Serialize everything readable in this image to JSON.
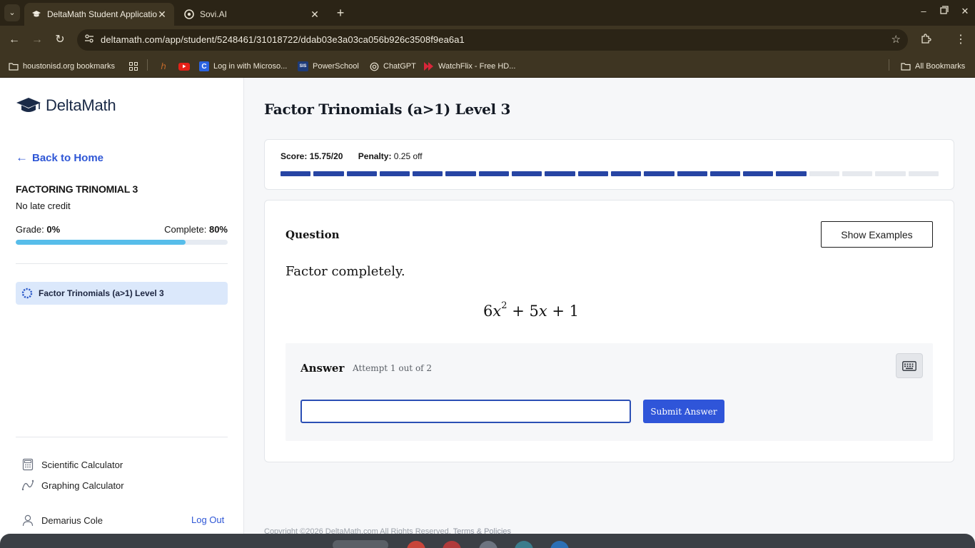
{
  "browser": {
    "tabs": [
      {
        "title": "DeltaMath Student Application",
        "active": true
      },
      {
        "title": "Sovi.AI",
        "active": false
      }
    ],
    "url": "deltamath.com/app/student/5248461/31018722/ddab03e3a03ca056b926c3508f9ea6a1",
    "bookmarks": [
      {
        "label": "houstonisd.org bookmarks",
        "icon": "folder-icon"
      },
      {
        "label": "",
        "icon": "apps-grid-icon"
      },
      {
        "label": "",
        "icon": "llama-icon"
      },
      {
        "label": "",
        "icon": "youtube-icon"
      },
      {
        "label": "Log in with Microso...",
        "icon": "clever-icon"
      },
      {
        "label": "PowerSchool",
        "icon": "powerschool-icon"
      },
      {
        "label": "ChatGPT",
        "icon": "chatgpt-icon"
      },
      {
        "label": "WatchFlix - Free HD...",
        "icon": "watchflix-icon"
      }
    ],
    "all_bookmarks": "All Bookmarks"
  },
  "sidebar": {
    "brand": "DeltaMath",
    "back_link": "Back to Home",
    "assignment_title": "FACTORING TRINOMIAL 3",
    "late_credit": "No late credit",
    "grade_label": "Grade:",
    "grade_value": "0%",
    "complete_label": "Complete:",
    "complete_value": "80%",
    "complete_fraction": 0.8,
    "skills": [
      {
        "label": "Factor Trinomials (a>1) Level 3",
        "selected": true
      }
    ],
    "tools": [
      {
        "label": "Scientific Calculator",
        "icon": "calculator-icon"
      },
      {
        "label": "Graphing Calculator",
        "icon": "graph-icon"
      }
    ],
    "user_name": "Demarius Cole",
    "logout": "Log Out"
  },
  "main": {
    "title": "Factor Trinomials (a>1) Level 3",
    "score_label": "Score:",
    "score_value": "15.75/20",
    "penalty_label": "Penalty:",
    "penalty_value": "0.25 off",
    "progress_segments_total": 20,
    "progress_segments_filled": 16,
    "question_label": "Question",
    "show_examples": "Show Examples",
    "prompt": "Factor completely.",
    "expression": {
      "coef": "6",
      "var": "x",
      "exp": "2",
      "rest_1": "+ 5",
      "var2": "x",
      "rest_2": "+ 1"
    },
    "answer_label": "Answer",
    "attempt": "Attempt 1 out of 2",
    "answer_value": "",
    "submit": "Submit Answer",
    "footer_copyright": "Copyright ©2026 DeltaMath.com All Rights Reserved.",
    "footer_terms": "Terms & Policies"
  },
  "colors": {
    "accent": "#2f55d9",
    "progress_filled": "#2745a4",
    "progress_empty": "#e6e9ee",
    "complete_bar": "#57bdea",
    "skill_highlight": "#dbe8fb"
  }
}
